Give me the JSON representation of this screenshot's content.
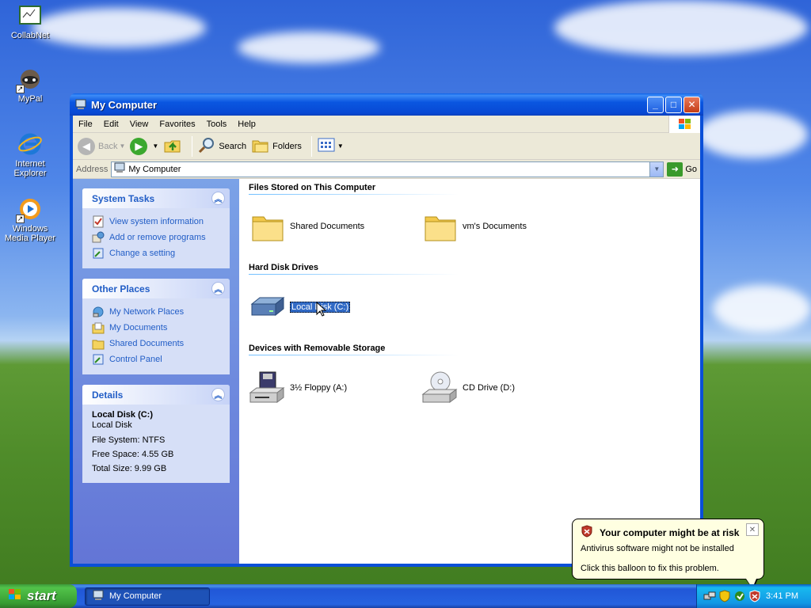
{
  "desktop": {
    "icons": [
      {
        "label": "CollabNet",
        "icon": "collabnet-icon"
      },
      {
        "label": "MyPal",
        "icon": "mypal-icon"
      },
      {
        "label": "Internet Explorer",
        "icon": "internet-explorer-icon"
      },
      {
        "label": "Windows Media Player",
        "icon": "media-player-icon"
      }
    ]
  },
  "window": {
    "title": "My Computer",
    "menu": [
      "File",
      "Edit",
      "View",
      "Favorites",
      "Tools",
      "Help"
    ],
    "toolbar": {
      "back": "Back",
      "search": "Search",
      "folders": "Folders"
    },
    "address": {
      "label": "Address",
      "value": "My Computer",
      "go": "Go"
    }
  },
  "leftpane": {
    "system_tasks": {
      "title": "System Tasks",
      "items": [
        "View system information",
        "Add or remove programs",
        "Change a setting"
      ]
    },
    "other_places": {
      "title": "Other Places",
      "items": [
        "My Network Places",
        "My Documents",
        "Shared Documents",
        "Control Panel"
      ]
    },
    "details": {
      "title": "Details",
      "name": "Local Disk (C:)",
      "type": "Local Disk",
      "file_system": "File System: NTFS",
      "free_space": "Free Space: 4.55 GB",
      "total_size": "Total Size: 9.99 GB"
    }
  },
  "main": {
    "groups": [
      {
        "title": "Files Stored on This Computer",
        "items": [
          "Shared Documents",
          "vm's Documents"
        ]
      },
      {
        "title": "Hard Disk Drives",
        "items": [
          "Local Disk (C:)"
        ]
      },
      {
        "title": "Devices with Removable Storage",
        "items": [
          "3½ Floppy (A:)",
          "CD Drive (D:)"
        ]
      }
    ]
  },
  "balloon": {
    "title": "Your computer might be at risk",
    "line1": "Antivirus software might not be installed",
    "line2": "Click this balloon to fix this problem."
  },
  "taskbar": {
    "start": "start",
    "task": "My Computer",
    "clock": "3:41 PM"
  },
  "colors": {
    "link": "#215dc6",
    "selection": "#316ac5",
    "balloon_bg": "#ffffe1"
  }
}
